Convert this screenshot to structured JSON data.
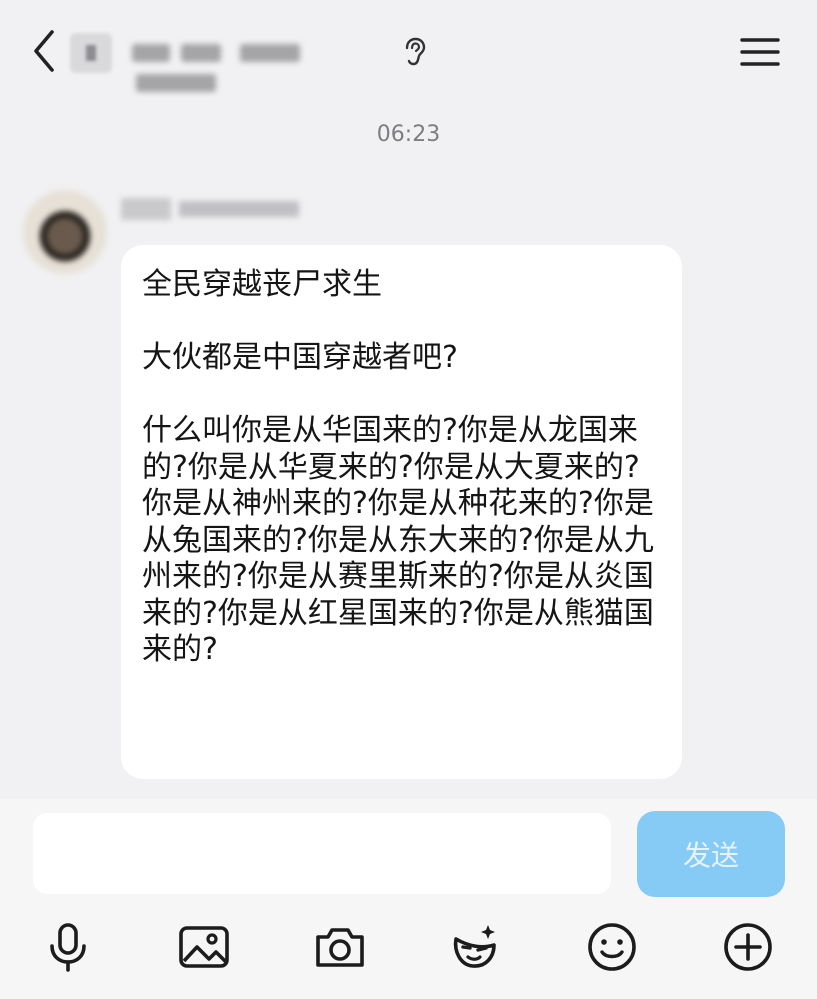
{
  "header": {
    "title": "",
    "icons": {
      "back": "chevron-left-icon",
      "ear": "ear-icon",
      "menu": "hamburger-menu-icon"
    }
  },
  "chat": {
    "timestamp": "06:23",
    "message": {
      "sender": "",
      "text": "全民穿越丧尸求生\n\n大伙都是中国穿越者吧?\n\n什么叫你是从华国来的?你是从龙国来的?你是从华夏来的?你是从大夏来的?你是从神州来的?你是从种花来的?你是从兔国来的?你是从东大来的?你是从九州来的?你是从赛里斯来的?你是从炎国来的?你是从红星国来的?你是从熊猫国来的?"
    }
  },
  "composer": {
    "input_value": "",
    "send_label": "发送",
    "send_color": "#86cbf6",
    "toolbar": [
      "microphone-icon",
      "image-icon",
      "camera-icon",
      "sticker-icon",
      "emoji-icon",
      "plus-icon"
    ]
  }
}
